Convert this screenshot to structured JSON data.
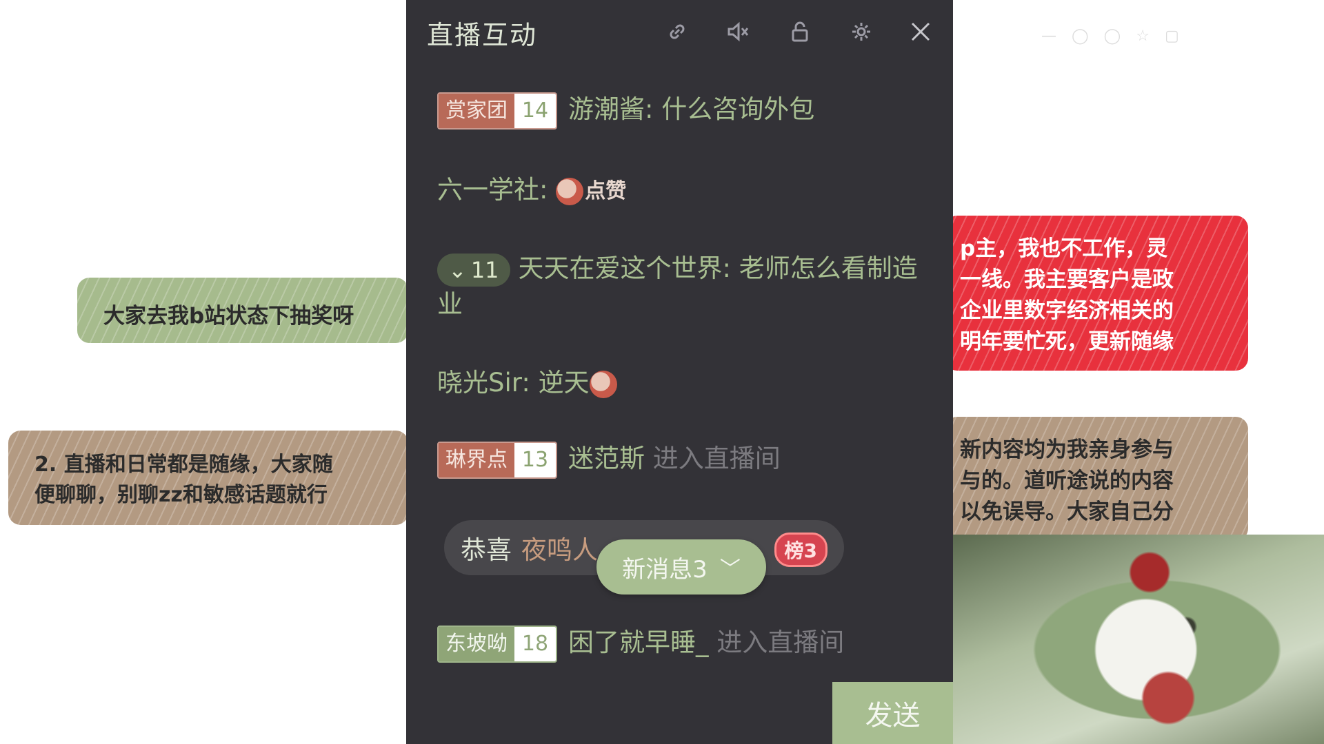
{
  "overlay": {
    "green_note": "大家去我b站状态下抽奖呀",
    "brown_note": [
      "2. 直播和日常都是随缘，大家随",
      "便聊聊，别聊zz和敏感话题就行"
    ],
    "red_note": [
      "p主，我也不工作，灵",
      "一线。我主要客户是政",
      "企业里数字经济相关的",
      "明年要忙死，更新随缘"
    ],
    "tan_note": [
      "新内容均为我亲身参与",
      "与的。道听途说的内容",
      "以免误导。大家自己分"
    ]
  },
  "panel": {
    "title": "直播互动",
    "toolbar_icons": [
      "link-icon",
      "mute-icon",
      "lock-icon",
      "gear-icon",
      "close-icon"
    ],
    "messages": [
      {
        "badge_name": "赏家团",
        "badge_level": "14",
        "user": "游潮酱",
        "text": "什么咨询外包"
      },
      {
        "user": "六一学社",
        "emote": "点赞"
      },
      {
        "rank": "11",
        "user": "天天在爱这个世界",
        "text": "老师怎么看制造业"
      },
      {
        "user": "晓光Sir",
        "text": "逆天"
      },
      {
        "badge_name": "琳界点",
        "badge_level": "13",
        "user": "迷范斯",
        "action": "进入直播间"
      },
      {
        "badge_name": "东坡呦",
        "badge_level": "18",
        "user": "困了就早睡_",
        "action": "进入直播间"
      }
    ],
    "gift": {
      "congrats": "恭喜",
      "user": "夜鸣人",
      "tag": "榜3"
    },
    "new_messages": "新消息3",
    "send_label": "发送"
  },
  "colors": {
    "panel_bg": "#333237",
    "accent_green": "#a8be91",
    "badge_red": "#b86a58",
    "note_red": "#e8313d"
  }
}
